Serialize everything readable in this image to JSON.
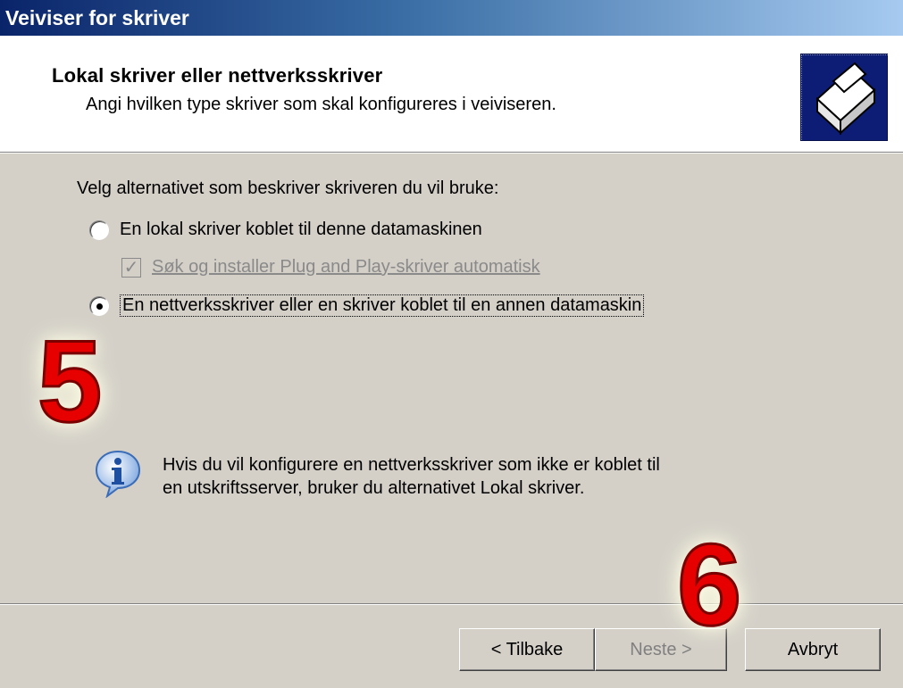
{
  "window": {
    "title": "Veiviser for skriver"
  },
  "header": {
    "title": "Lokal skriver eller nettverksskriver",
    "subtitle": "Angi hvilken type skriver som skal konfigureres i veiviseren.",
    "icon": "printer-icon"
  },
  "prompt": "Velg alternativet som beskriver skriveren du vil bruke:",
  "options": {
    "local": {
      "label": "En lokal skriver koblet til denne datamaskinen",
      "selected": false
    },
    "plug_and_play": {
      "label": "Søk og installer Plug and Play-skriver automatisk",
      "checked": true,
      "enabled": false
    },
    "network": {
      "label": "En nettverksskriver eller en skriver koblet til en annen datamaskin",
      "selected": true
    }
  },
  "info": {
    "icon": "info-icon",
    "line1": "Hvis du vil konfigurere en nettverksskriver som ikke er koblet til",
    "line2": "en utskriftsserver, bruker du alternativet Lokal skriver."
  },
  "annotations": {
    "step5": "5",
    "step6": "6",
    "color": "#e60000"
  },
  "buttons": {
    "back": "< Tilbake",
    "next": "Neste >",
    "cancel": "Avbryt"
  }
}
